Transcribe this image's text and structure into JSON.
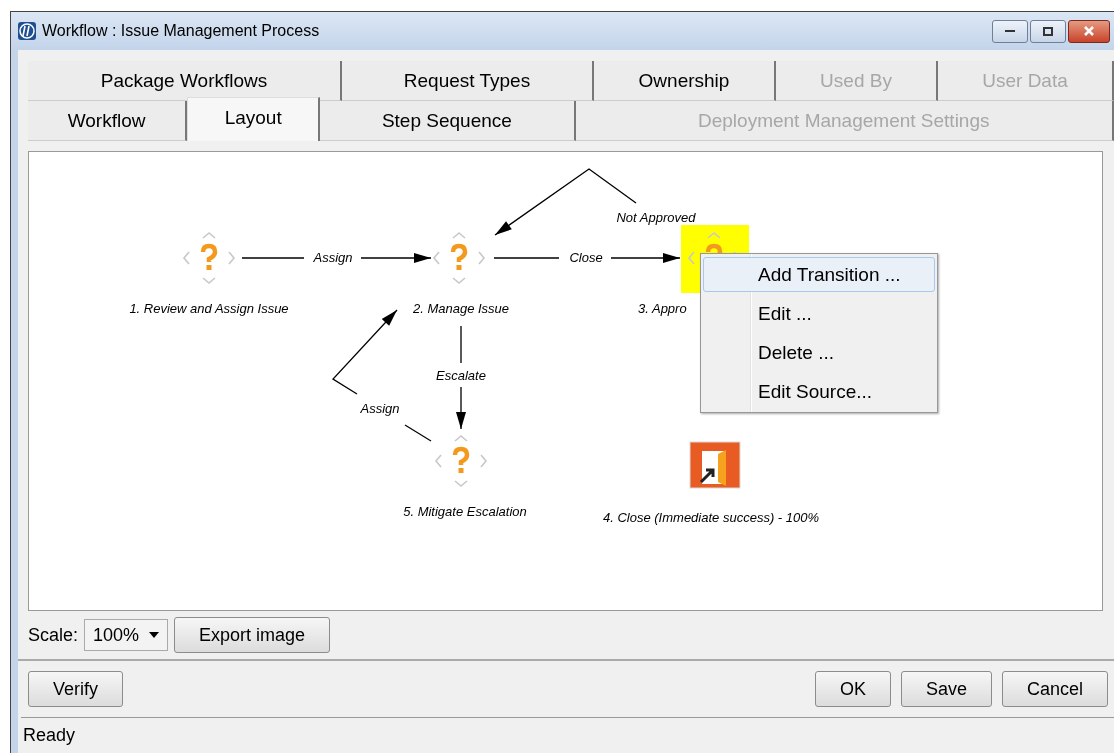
{
  "window": {
    "title": "Workflow : Issue Management Process"
  },
  "tab_rows": [
    {
      "tabs": [
        {
          "label": "Package Workflows",
          "selected": false,
          "disabled": false
        },
        {
          "label": "Request Types",
          "selected": false,
          "disabled": false
        },
        {
          "label": "Ownership",
          "selected": false,
          "disabled": false
        },
        {
          "label": "Used By",
          "selected": false,
          "disabled": true
        },
        {
          "label": "User Data",
          "selected": false,
          "disabled": true
        }
      ]
    },
    {
      "tabs": [
        {
          "label": "Workflow",
          "selected": false,
          "disabled": false
        },
        {
          "label": "Layout",
          "selected": true,
          "disabled": false
        },
        {
          "label": "Step Sequence",
          "selected": false,
          "disabled": false
        },
        {
          "label": "Deployment Management Settings",
          "selected": false,
          "disabled": true
        }
      ]
    }
  ],
  "diagram": {
    "nodes": [
      {
        "label": "1. Review and Assign Issue",
        "kind": "decision",
        "selected": false
      },
      {
        "label": "2. Manage Issue",
        "kind": "decision",
        "selected": false
      },
      {
        "label": "3. Appro",
        "kind": "decision",
        "selected": true
      },
      {
        "label": "5. Mitigate Escalation",
        "kind": "decision",
        "selected": false
      },
      {
        "label": "4. Close (Immediate success) - 100%",
        "kind": "close",
        "selected": false
      }
    ],
    "transitions": [
      {
        "label": "Assign"
      },
      {
        "label": "Close"
      },
      {
        "label": "Not Approved"
      },
      {
        "label": "Escalate"
      },
      {
        "label": "Assign"
      }
    ]
  },
  "context_menu": {
    "items": [
      {
        "label": "Add Transition ...",
        "selected": true
      },
      {
        "label": "Edit ...",
        "selected": false
      },
      {
        "label": "Delete ...",
        "selected": false
      },
      {
        "label": "Edit Source...",
        "selected": false
      }
    ]
  },
  "scale": {
    "label": "Scale:",
    "value": "100%"
  },
  "export_button": "Export image",
  "buttons_left": [
    "Verify"
  ],
  "buttons_right": [
    "OK",
    "Save",
    "Cancel"
  ],
  "status_bar": "Ready"
}
